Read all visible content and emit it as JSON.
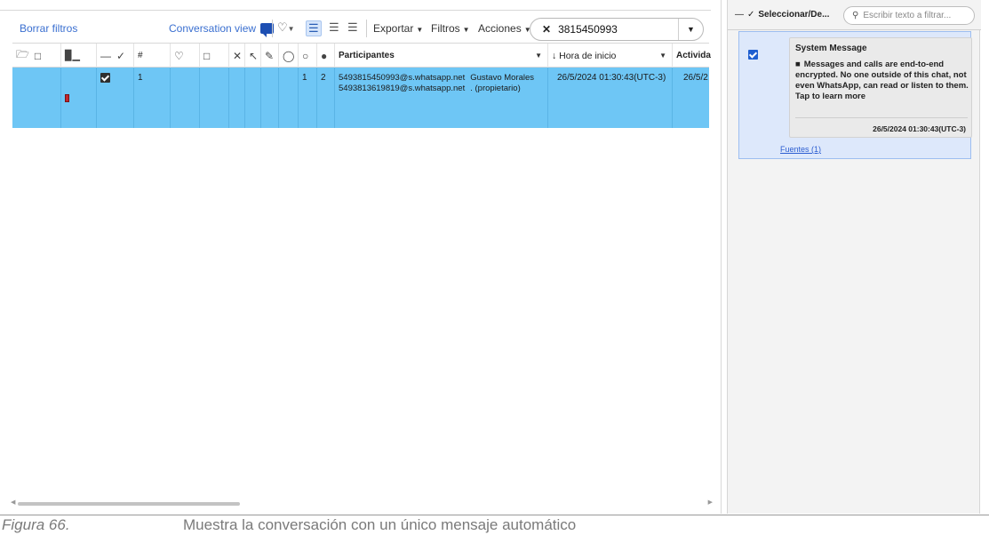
{
  "toolbar": {
    "clear_filters": "Borrar filtros",
    "conversation_view": "Conversation view",
    "export": "Exportar",
    "filters": "Filtros",
    "actions": "Acciones",
    "search_value": "3815450993"
  },
  "grid": {
    "headers": {
      "number": "#",
      "participants": "Participantes",
      "start_time": "↓ Hora de inicio",
      "activity": "Activida"
    },
    "row": {
      "number": "1",
      "count_a": "1",
      "count_b": "2",
      "participant_1": "5493815450993@s.whatsapp.net",
      "participant_1_name": "Gustavo Morales",
      "participant_2": "5493813619819@s.whatsapp.net",
      "participant_2_name": ". (propietario)",
      "start_time": "26/5/2024 01:30:43(UTC-3)",
      "activity": "26/5/2"
    },
    "row_color": "#6ec6f5",
    "flag_color": "#c1272d"
  },
  "right_panel": {
    "select_label": "Seleccionar/De...",
    "search_placeholder": "Escribir texto a filtrar...",
    "message": {
      "title": "System Message",
      "text": "Messages and calls are end-to-end encrypted. No one outside of this chat, not even WhatsApp, can read or listen to them. Tap to learn more",
      "timestamp": "26/5/2024 01:30:43(UTC-3)"
    },
    "sources": "Fuentes (1)"
  },
  "caption": {
    "figure": "Figura 66.",
    "text": "Muestra la conversación con un único mensaje automático"
  }
}
